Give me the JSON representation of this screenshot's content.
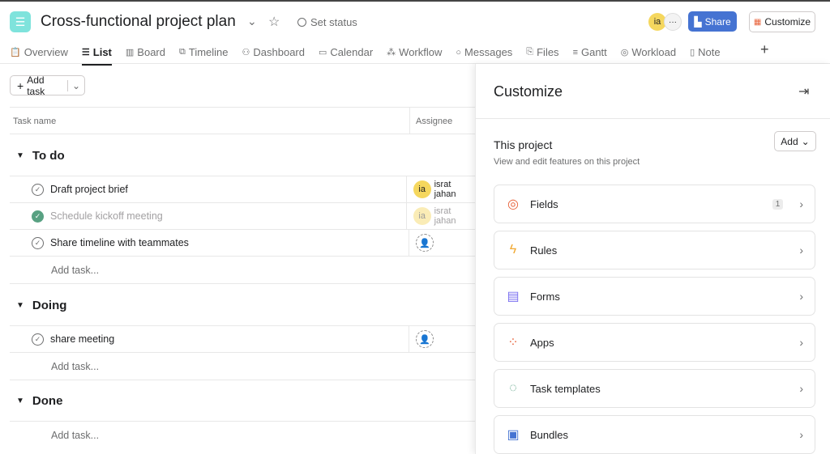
{
  "header": {
    "title": "Cross-functional project plan",
    "set_status": "Set status",
    "avatar_initials": "ia",
    "share": "Share",
    "customize": "Customize"
  },
  "tabs": [
    {
      "label": "Overview",
      "icon": "📋"
    },
    {
      "label": "List",
      "icon": "☰"
    },
    {
      "label": "Board",
      "icon": "▥"
    },
    {
      "label": "Timeline",
      "icon": "⧉"
    },
    {
      "label": "Dashboard",
      "icon": "⚇"
    },
    {
      "label": "Calendar",
      "icon": "▭"
    },
    {
      "label": "Workflow",
      "icon": "⁂"
    },
    {
      "label": "Messages",
      "icon": "○"
    },
    {
      "label": "Files",
      "icon": "⎘"
    },
    {
      "label": "Gantt",
      "icon": "≡"
    },
    {
      "label": "Workload",
      "icon": "◎"
    },
    {
      "label": "Note",
      "icon": "▯"
    }
  ],
  "list": {
    "add_task": "Add task",
    "col_task": "Task name",
    "col_assignee": "Assignee",
    "sections": [
      {
        "name": "To do",
        "tasks": [
          {
            "name": "Draft project brief",
            "done": false,
            "assignee": "israt jahan"
          },
          {
            "name": "Schedule kickoff meeting",
            "done": true,
            "assignee": "israt jahan"
          },
          {
            "name": "Share timeline with teammates",
            "done": false,
            "assignee": ""
          }
        ]
      },
      {
        "name": "Doing",
        "tasks": [
          {
            "name": "share meeting",
            "done": false,
            "assignee": ""
          }
        ]
      },
      {
        "name": "Done",
        "tasks": []
      }
    ],
    "add_task_row": "Add task..."
  },
  "panel": {
    "title": "Customize",
    "section_title": "This project",
    "section_sub": "View and edit features on this project",
    "add": "Add",
    "items": [
      {
        "label": "Fields",
        "badge": "1",
        "color": "#e8643c"
      },
      {
        "label": "Rules",
        "color": "#f1a831"
      },
      {
        "label": "Forms",
        "color": "#7a6ff0"
      },
      {
        "label": "Apps",
        "color": "#e8643c"
      },
      {
        "label": "Task templates",
        "color": "#58a182"
      },
      {
        "label": "Bundles",
        "color": "#4573d2"
      }
    ]
  }
}
